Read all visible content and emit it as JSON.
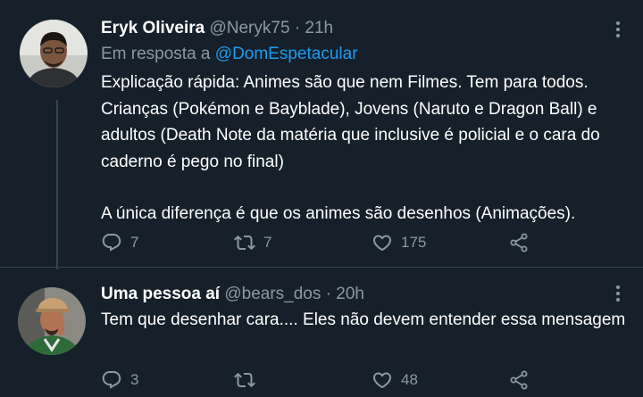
{
  "tweets": [
    {
      "display_name": "Eryk Oliveira",
      "handle": "@Neryk75",
      "separator": "·",
      "time": "21h",
      "reply_prefix": "Em resposta a",
      "reply_handle": "@DomEspetacular",
      "paragraphs": [
        "Explicação rápida: Animes são que nem Filmes. Tem para todos. Crianças (Pokémon e Bayblade), Jovens (Naruto e Dragon Ball) e adultos (Death Note da matéria que inclusive é policial e o cara do caderno é pego no final)",
        "A única diferença é que os animes são desenhos (Animações)."
      ],
      "replies": "7",
      "retweets": "7",
      "likes": "175"
    },
    {
      "display_name": "Uma pessoa aí",
      "handle": "@bears_dos",
      "separator": "·",
      "time": "20h",
      "paragraphs": [
        "Tem que desenhar cara.... Eles não devem entender essa mensagem"
      ],
      "replies": "3",
      "retweets": "",
      "likes": "48"
    }
  ],
  "colors": {
    "background": "#15202b",
    "text": "#ffffff",
    "secondary": "#8b98a5",
    "link": "#1d9bf0",
    "divider": "#38444d"
  },
  "icons": [
    "more-icon",
    "reply-icon",
    "retweet-icon",
    "like-icon",
    "share-icon"
  ]
}
